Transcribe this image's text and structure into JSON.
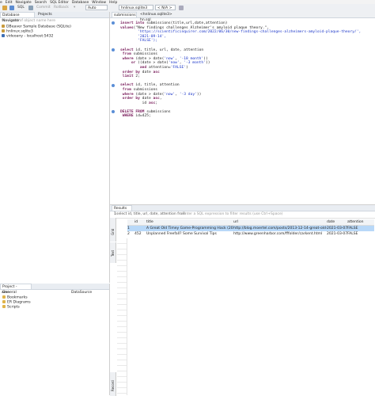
{
  "menubar": {
    "items": [
      "e",
      "Edit",
      "Navigate",
      "Search",
      "SQL Editor",
      "Database",
      "Window",
      "Help"
    ]
  },
  "toolbar": {
    "sql_label": "SQL",
    "commit_label": "Commit",
    "rollback_label": "Rollback",
    "auto_label": "Auto",
    "connection_combo": "hnlinux.sqlite3",
    "schema_combo": "< N/A >"
  },
  "navigator": {
    "tab_db": "Database Navigator",
    "tab_projects": "Projects",
    "filter_placeholder": "ter a part of object name here",
    "items": [
      {
        "label": "DBeaver Sample Database (SQLite)",
        "icon": "database-icon"
      },
      {
        "label": "hnlinux.sqlite3",
        "icon": "database-icon"
      },
      {
        "label": "videoany - localhost:5432",
        "icon": "postgres-icon"
      }
    ]
  },
  "project_panel": {
    "title": "Project - General",
    "col_name": "ame",
    "col_datasource": "DataSource",
    "items": [
      {
        "label": "Bookmarks",
        "icon": "bookmark-folder-icon"
      },
      {
        "label": "ER Diagrams",
        "icon": "er-diagram-folder-icon"
      },
      {
        "label": "Scripts",
        "icon": "scripts-folder-icon"
      }
    ]
  },
  "editor": {
    "tab_active": "submissions",
    "tab_second": "<hnlinux.sqlite3> hn.sql",
    "lines": [
      [
        {
          "t": "insert into ",
          "k": "kw"
        },
        {
          "t": "submissions(title,url,date,attention)",
          "k": ""
        }
      ],
      [
        {
          "t": "values",
          "k": "kw"
        },
        {
          "t": "(\"New findings challenges Alzheimer's amyloid plaque theory.\",",
          "k": ""
        }
      ],
      [
        {
          "t": "        'https://scientificinquirer.com/2022/06/30/new-findings-challenges-alzheimers-amyloid-plaque-theory/',",
          "k": "str"
        }
      ],
      [
        {
          "t": "        '2021-09-14',",
          "k": "str"
        }
      ],
      [
        {
          "t": "        'FALSE');",
          "k": "str"
        }
      ],
      [
        {
          "t": "",
          "k": ""
        }
      ],
      [
        {
          "t": "select ",
          "k": "kw"
        },
        {
          "t": "id, title, url, date, attention",
          "k": ""
        }
      ],
      [
        {
          "t": " from ",
          "k": "kw"
        },
        {
          "t": "submissions",
          "k": ""
        }
      ],
      [
        {
          "t": " where ",
          "k": "kw"
        },
        {
          "t": "(date > date(",
          "k": ""
        },
        {
          "t": "'now'",
          "k": "str"
        },
        {
          "t": ", ",
          "k": ""
        },
        {
          "t": "'-18 month'",
          "k": "str"
        },
        {
          "t": "))",
          "k": ""
        }
      ],
      [
        {
          "t": "     or ",
          "k": "kw"
        },
        {
          "t": "((date > date(",
          "k": ""
        },
        {
          "t": "'now'",
          "k": "str"
        },
        {
          "t": ", ",
          "k": ""
        },
        {
          "t": "'-3 month'",
          "k": "str"
        },
        {
          "t": "))",
          "k": ""
        }
      ],
      [
        {
          "t": "         and ",
          "k": "kw"
        },
        {
          "t": "attention=",
          "k": ""
        },
        {
          "t": "'FALSE'",
          "k": "str"
        },
        {
          "t": ")",
          "k": ""
        }
      ],
      [
        {
          "t": " order by ",
          "k": "kw"
        },
        {
          "t": "date ",
          "k": ""
        },
        {
          "t": "asc",
          "k": "kw"
        }
      ],
      [
        {
          "t": " limit ",
          "k": "kw"
        },
        {
          "t": "2;",
          "k": ""
        }
      ],
      [
        {
          "t": "",
          "k": ""
        }
      ],
      [
        {
          "t": "select ",
          "k": "kw"
        },
        {
          "t": "id, title, attention",
          "k": ""
        }
      ],
      [
        {
          "t": " from ",
          "k": "kw"
        },
        {
          "t": "submissions",
          "k": ""
        }
      ],
      [
        {
          "t": " where ",
          "k": "kw"
        },
        {
          "t": "(date > date(",
          "k": ""
        },
        {
          "t": "'now'",
          "k": "str"
        },
        {
          "t": ", ",
          "k": ""
        },
        {
          "t": "'-3 day'",
          "k": "str"
        },
        {
          "t": "))",
          "k": ""
        }
      ],
      [
        {
          "t": " order by ",
          "k": "kw"
        },
        {
          "t": "date ",
          "k": ""
        },
        {
          "t": "asc",
          "k": "kw"
        },
        {
          "t": ",",
          "k": ""
        }
      ],
      [
        {
          "t": "          id ",
          "k": ""
        },
        {
          "t": "asc",
          "k": "kw"
        },
        {
          "t": ";",
          "k": ""
        }
      ],
      [
        {
          "t": "",
          "k": ""
        }
      ],
      [
        {
          "t": "DELETE FROM ",
          "k": "kw"
        },
        {
          "t": "submissions",
          "k": ""
        }
      ],
      [
        {
          "t": " WHERE ",
          "k": "kw"
        },
        {
          "t": "id=425;",
          "k": ""
        }
      ]
    ]
  },
  "results": {
    "tab_label": "Results 1",
    "query_text": "select id, title, url, date, attention from",
    "filter_placeholder": "Enter a SQL expression to filter results (use Ctrl+Space)",
    "side_tabs": [
      "Grid",
      "Text",
      "Record"
    ],
    "columns": [
      "id",
      "title",
      "url",
      "date",
      "attention"
    ],
    "rows": [
      {
        "num": "1",
        "id": "",
        "title": "A Great Old Timey Game-Programming Hack (2013)",
        "url": "http://blog.moertel.com/posts/2013-12-14-great-old-tim",
        "date": "2021-03-07",
        "attention": "FALSE",
        "selected": true
      },
      {
        "num": "2",
        "id": "452",
        "title": "Unplanned Freefall? Some Survival Tips",
        "url": "http://www.greenharbor.com/fffolder/carkent.html",
        "date": "2021-03-07",
        "attention": "FALSE",
        "selected": false
      }
    ]
  },
  "colors": {
    "selection": "#b8d8f8",
    "keyword": "#7a1e5c",
    "string": "#1a35c8"
  }
}
